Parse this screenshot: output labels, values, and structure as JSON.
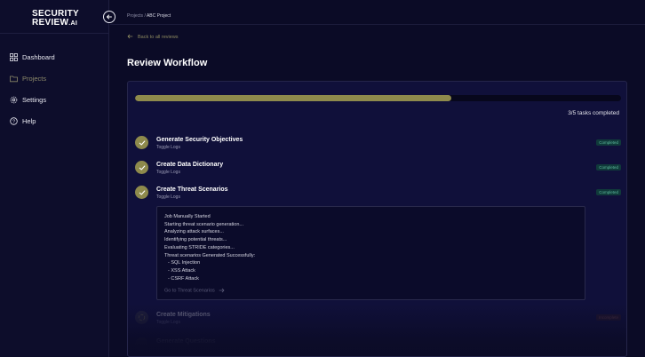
{
  "brand": {
    "line1": "SECURITY",
    "line2": "REVIEW",
    "line2_suffix": ".AI"
  },
  "sidebar": {
    "items": [
      {
        "label": "Dashboard",
        "icon": "grid-icon",
        "active": false
      },
      {
        "label": "Projects",
        "icon": "folder-icon",
        "active": true
      },
      {
        "label": "Settings",
        "icon": "gear-icon",
        "active": false
      },
      {
        "label": "Help",
        "icon": "help-circle-icon",
        "active": false
      }
    ]
  },
  "breadcrumb": {
    "root": "Projects",
    "separator": " / ",
    "current": "ABC Project"
  },
  "back_link": "Back to all reviews",
  "page_title": "Review Workflow",
  "progress": {
    "fraction": 0.65,
    "text": "3/5 tasks completed"
  },
  "tasks": [
    {
      "name": "Generate Security Objectives",
      "link": "Toggle Logs",
      "status": "Completed"
    },
    {
      "name": "Create Data Dictionary",
      "link": "Toggle Logs",
      "status": "Completed"
    },
    {
      "name": "Create Threat Scenarios",
      "link": "Toggle Logs",
      "status": "Completed"
    },
    {
      "name": "Create Mitigations",
      "link": "Toggle Logs",
      "status": "Incomplete"
    },
    {
      "name": "Generate Questions",
      "link": "",
      "status": ""
    }
  ],
  "log": {
    "lines": [
      "Job Manually Started",
      "Starting threat scenario generation...",
      "Analyzing attack surfaces...",
      "Identifying potential threats...",
      "Evaluating STRIDE categories...",
      "Threat scenarios Generated Successfully:"
    ],
    "items": [
      "-  SQL Injection",
      "-  XSS Attack",
      "-  CSRF Attack"
    ],
    "link": "Go to Threat Scenarios"
  },
  "colors": {
    "accent": "#8e8a4c",
    "background": "#0b0b26",
    "panel": "#10103a",
    "completed_badge": "#5cb89c"
  }
}
